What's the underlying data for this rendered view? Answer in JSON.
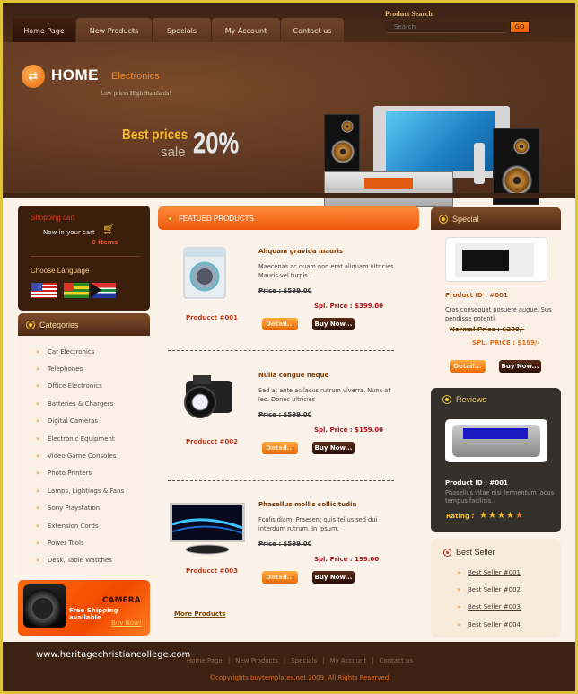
{
  "header": {
    "nav": [
      {
        "label": "Home Page",
        "active": true
      },
      {
        "label": "New Products",
        "active": false
      },
      {
        "label": "Specials",
        "active": false
      },
      {
        "label": "My Account",
        "active": false
      },
      {
        "label": "Contact us",
        "active": false
      }
    ],
    "search": {
      "title": "Product Search",
      "placeholder": "Search",
      "button": "GO"
    }
  },
  "banner": {
    "logo_icon": "arrows-logo-icon",
    "logo_main": "HOME",
    "logo_sub": "Electronics",
    "tagline": "Low prices High Standards!",
    "promo_line1": "Best prices",
    "promo_line2": "sale",
    "promo_percent": "20%"
  },
  "cart": {
    "title": "Shopping cart",
    "label": "Now in your cart",
    "icon": "cart-icon",
    "count": "0 items",
    "language_title": "Choose Language",
    "languages": [
      "United States flag",
      "Togo flag",
      "South Africa flag"
    ]
  },
  "categories": {
    "title": "Categories",
    "items": [
      "Car Electronics",
      "Telephones",
      "Office Electronics",
      "Batteries & Chargers",
      "Digital Cameras",
      "Electronic Equipment",
      "Video Game Consoles",
      "Photo Printers",
      "Lamps, Lightings & Fans",
      "Sony Playstation",
      "Extension Cords",
      "Power Tools",
      "Desk, Table Watches"
    ]
  },
  "camera_ad": {
    "title": "CAMERA",
    "subtitle": "Free Shipping available",
    "link": "Buy Now!"
  },
  "featured": {
    "title": "FEATUED PRODUCTS",
    "products": [
      {
        "id": "Producct #001",
        "name": "Aliquam gravida mauris",
        "desc": "Maecenas ac quam non erat aliquam ultricies. Mauris vel turpis .",
        "price": "Price : $599.00",
        "spl_price": "Spl. Price : $399.00",
        "image": "washing-machine",
        "detail": "Detail...",
        "buy": "Buy Now..."
      },
      {
        "id": "Producct #002",
        "name": "Nulla congue neque",
        "desc": "Sed at ante ac lacus rutrum viverra. Nunc at leo. Donec ultricies",
        "price": "Price : $599.00",
        "spl_price": "Spl. Price : $159.00",
        "image": "camera",
        "detail": "Detail...",
        "buy": "Buy Now..."
      },
      {
        "id": "Producct #003",
        "name": "Phasellus mollis sollicitudin",
        "desc": "Fculis diam. Praesent quis tellus sed dui interdum rutrum. In ipsum.",
        "price": "Price : $599.00",
        "spl_price": "Spl. Price : 199.00",
        "image": "monitor",
        "detail": "Detail...",
        "buy": "Buy Now..."
      }
    ],
    "more": "More Products"
  },
  "special": {
    "title": "Special",
    "product_id": "Product ID : #001",
    "desc": "Cras consequat posuere augue. Sus pendisse potenti.",
    "normal_price": "Normal Price : $299/-",
    "spl_price": "SPL. PRICE : $199/-",
    "detail": "Detail...",
    "buy": "Buy Now..."
  },
  "reviews": {
    "title": "Reviews",
    "product_id": "Product ID : #001",
    "desc": "Phasellus vitae nisi fermentum lacus tempus facilisis.",
    "rating_label": "Rating :",
    "rating": 5,
    "rating_max": 5
  },
  "best_seller": {
    "title": "Best Seller",
    "items": [
      "Best Seller #001",
      "Best Seller #002",
      "Best Seller #003",
      "Best Seller #004"
    ]
  },
  "footer": {
    "site_url": "www.heritagechristiancollege.com",
    "nav": [
      "Home Page",
      "New Products",
      "Specials",
      "My Account",
      "Contact us"
    ],
    "copyright": "©copyrights buytemplates.net 2009. All Rights Reserved."
  },
  "colors": {
    "accent": "#ee5a10",
    "brand_brown": "#3c1e0d",
    "frame": "#e1c33a",
    "price_red": "#b2101a"
  }
}
